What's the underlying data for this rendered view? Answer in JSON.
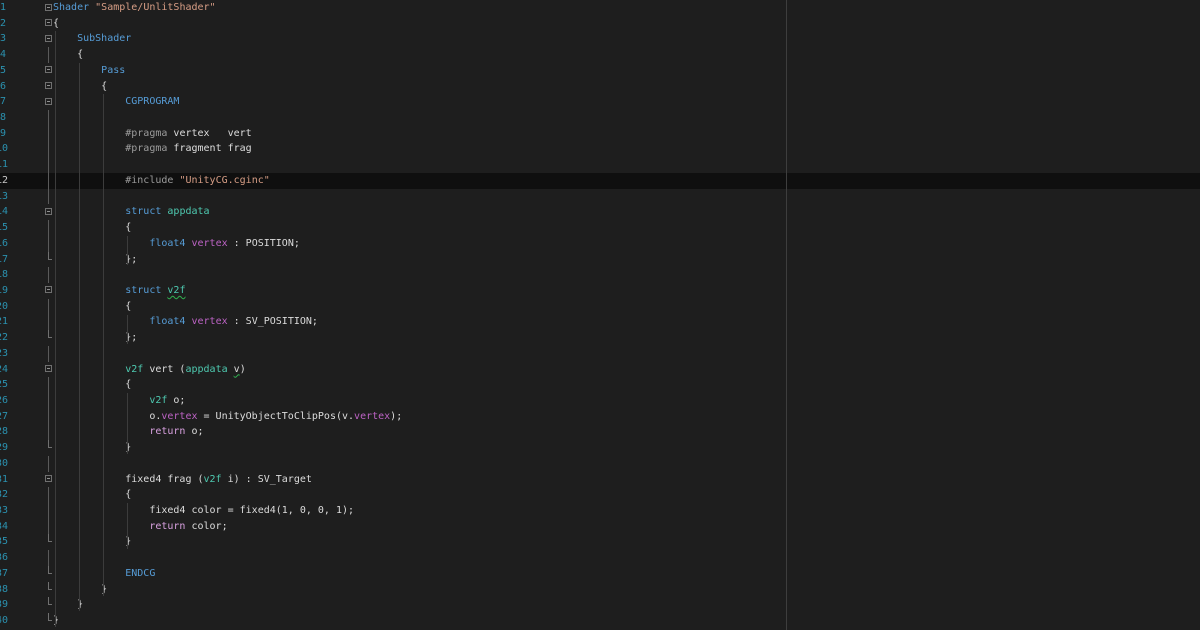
{
  "editor": {
    "current_line": 12,
    "lines": [
      {
        "num": "1",
        "fold": "open",
        "tokens": [
          {
            "t": "Shader",
            "c": "kw"
          },
          {
            "t": " ",
            "c": "plain"
          },
          {
            "t": "\"Sample/UnlitShader\"",
            "c": "str"
          }
        ]
      },
      {
        "num": "2",
        "fold": "open",
        "tokens": [
          {
            "t": "{",
            "c": "plain"
          }
        ]
      },
      {
        "num": "3",
        "fold": "open",
        "tokens": [
          {
            "t": "    ",
            "c": "plain"
          },
          {
            "t": "SubShader",
            "c": "kw"
          }
        ]
      },
      {
        "num": "4",
        "fold": "bar",
        "tokens": [
          {
            "t": "    {",
            "c": "plain"
          }
        ]
      },
      {
        "num": "5",
        "fold": "open",
        "tokens": [
          {
            "t": "        ",
            "c": "plain"
          },
          {
            "t": "Pass",
            "c": "kw"
          }
        ]
      },
      {
        "num": "6",
        "fold": "open",
        "tokens": [
          {
            "t": "        {",
            "c": "plain"
          }
        ]
      },
      {
        "num": "7",
        "fold": "open",
        "tokens": [
          {
            "t": "            ",
            "c": "plain"
          },
          {
            "t": "CGPROGRAM",
            "c": "cg"
          }
        ]
      },
      {
        "num": "8",
        "fold": "bar",
        "tokens": []
      },
      {
        "num": "9",
        "fold": "bar",
        "tokens": [
          {
            "t": "            ",
            "c": "plain"
          },
          {
            "t": "#pragma",
            "c": "pre"
          },
          {
            "t": " vertex   vert",
            "c": "plain"
          }
        ]
      },
      {
        "num": "10",
        "fold": "bar",
        "tokens": [
          {
            "t": "            ",
            "c": "plain"
          },
          {
            "t": "#pragma",
            "c": "pre"
          },
          {
            "t": " fragment frag",
            "c": "plain"
          }
        ]
      },
      {
        "num": "11",
        "fold": "bar",
        "tokens": []
      },
      {
        "num": "12",
        "fold": "bar",
        "tokens": [
          {
            "t": "            ",
            "c": "plain"
          },
          {
            "t": "#include",
            "c": "pre"
          },
          {
            "t": " ",
            "c": "plain"
          },
          {
            "t": "\"UnityCG.cginc\"",
            "c": "str"
          }
        ]
      },
      {
        "num": "13",
        "fold": "bar",
        "tokens": []
      },
      {
        "num": "14",
        "fold": "open",
        "tokens": [
          {
            "t": "            ",
            "c": "plain"
          },
          {
            "t": "struct",
            "c": "kw"
          },
          {
            "t": " ",
            "c": "plain"
          },
          {
            "t": "appdata",
            "c": "type"
          }
        ]
      },
      {
        "num": "15",
        "fold": "bar",
        "tokens": [
          {
            "t": "            {",
            "c": "plain"
          }
        ]
      },
      {
        "num": "16",
        "fold": "bar",
        "tokens": [
          {
            "t": "                ",
            "c": "plain"
          },
          {
            "t": "float4",
            "c": "kw"
          },
          {
            "t": " ",
            "c": "plain"
          },
          {
            "t": "vertex",
            "c": "mac"
          },
          {
            "t": " : POSITION;",
            "c": "plain"
          }
        ]
      },
      {
        "num": "17",
        "fold": "end",
        "tokens": [
          {
            "t": "            };",
            "c": "plain"
          }
        ]
      },
      {
        "num": "18",
        "fold": "bar",
        "tokens": []
      },
      {
        "num": "19",
        "fold": "open",
        "tokens": [
          {
            "t": "            ",
            "c": "plain"
          },
          {
            "t": "struct",
            "c": "kw"
          },
          {
            "t": " ",
            "c": "plain"
          },
          {
            "t": "v2f",
            "c": "type",
            "squig": true
          }
        ]
      },
      {
        "num": "20",
        "fold": "bar",
        "tokens": [
          {
            "t": "            {",
            "c": "plain"
          }
        ]
      },
      {
        "num": "21",
        "fold": "bar",
        "tokens": [
          {
            "t": "                ",
            "c": "plain"
          },
          {
            "t": "float4",
            "c": "kw"
          },
          {
            "t": " ",
            "c": "plain"
          },
          {
            "t": "vertex",
            "c": "mac"
          },
          {
            "t": " : SV_POSITION;",
            "c": "plain"
          }
        ]
      },
      {
        "num": "22",
        "fold": "end",
        "tokens": [
          {
            "t": "            };",
            "c": "plain"
          }
        ]
      },
      {
        "num": "23",
        "fold": "bar",
        "tokens": []
      },
      {
        "num": "24",
        "fold": "open",
        "tokens": [
          {
            "t": "            ",
            "c": "plain"
          },
          {
            "t": "v2f",
            "c": "type"
          },
          {
            "t": " vert (",
            "c": "plain"
          },
          {
            "t": "appdata",
            "c": "type"
          },
          {
            "t": " ",
            "c": "plain"
          },
          {
            "t": "v",
            "c": "plain",
            "squig": true
          },
          {
            "t": ")",
            "c": "plain"
          }
        ]
      },
      {
        "num": "25",
        "fold": "bar",
        "tokens": [
          {
            "t": "            {",
            "c": "plain"
          }
        ]
      },
      {
        "num": "26",
        "fold": "bar",
        "tokens": [
          {
            "t": "                ",
            "c": "plain"
          },
          {
            "t": "v2f",
            "c": "type"
          },
          {
            "t": " o;",
            "c": "plain"
          }
        ]
      },
      {
        "num": "27",
        "fold": "bar",
        "tokens": [
          {
            "t": "                o.",
            "c": "plain"
          },
          {
            "t": "vertex",
            "c": "mac"
          },
          {
            "t": " = UnityObjectToClipPos(v.",
            "c": "plain"
          },
          {
            "t": "vertex",
            "c": "mac"
          },
          {
            "t": ");",
            "c": "plain"
          }
        ]
      },
      {
        "num": "28",
        "fold": "bar",
        "tokens": [
          {
            "t": "                ",
            "c": "plain"
          },
          {
            "t": "return",
            "c": "ctl"
          },
          {
            "t": " o;",
            "c": "plain"
          }
        ]
      },
      {
        "num": "29",
        "fold": "end",
        "tokens": [
          {
            "t": "            }",
            "c": "plain"
          }
        ]
      },
      {
        "num": "30",
        "fold": "bar",
        "tokens": []
      },
      {
        "num": "31",
        "fold": "open",
        "tokens": [
          {
            "t": "            fixed4 frag (",
            "c": "plain"
          },
          {
            "t": "v2f",
            "c": "type"
          },
          {
            "t": " i) : SV_Target",
            "c": "plain"
          }
        ]
      },
      {
        "num": "32",
        "fold": "bar",
        "tokens": [
          {
            "t": "            {",
            "c": "plain"
          }
        ]
      },
      {
        "num": "33",
        "fold": "bar",
        "tokens": [
          {
            "t": "                fixed4 color = fixed4(1, 0, 0, 1);",
            "c": "plain"
          }
        ]
      },
      {
        "num": "34",
        "fold": "bar",
        "tokens": [
          {
            "t": "                ",
            "c": "plain"
          },
          {
            "t": "return",
            "c": "ctl"
          },
          {
            "t": " color;",
            "c": "plain"
          }
        ]
      },
      {
        "num": "35",
        "fold": "end",
        "tokens": [
          {
            "t": "            }",
            "c": "plain"
          }
        ]
      },
      {
        "num": "36",
        "fold": "bar",
        "tokens": []
      },
      {
        "num": "37",
        "fold": "end",
        "tokens": [
          {
            "t": "            ",
            "c": "plain"
          },
          {
            "t": "ENDCG",
            "c": "cg"
          }
        ]
      },
      {
        "num": "38",
        "fold": "end",
        "tokens": [
          {
            "t": "        }",
            "c": "plain"
          }
        ]
      },
      {
        "num": "39",
        "fold": "end",
        "tokens": [
          {
            "t": "    }",
            "c": "plain"
          }
        ]
      },
      {
        "num": "40",
        "fold": "end",
        "tokens": [
          {
            "t": "}",
            "c": "plain"
          }
        ]
      }
    ]
  }
}
